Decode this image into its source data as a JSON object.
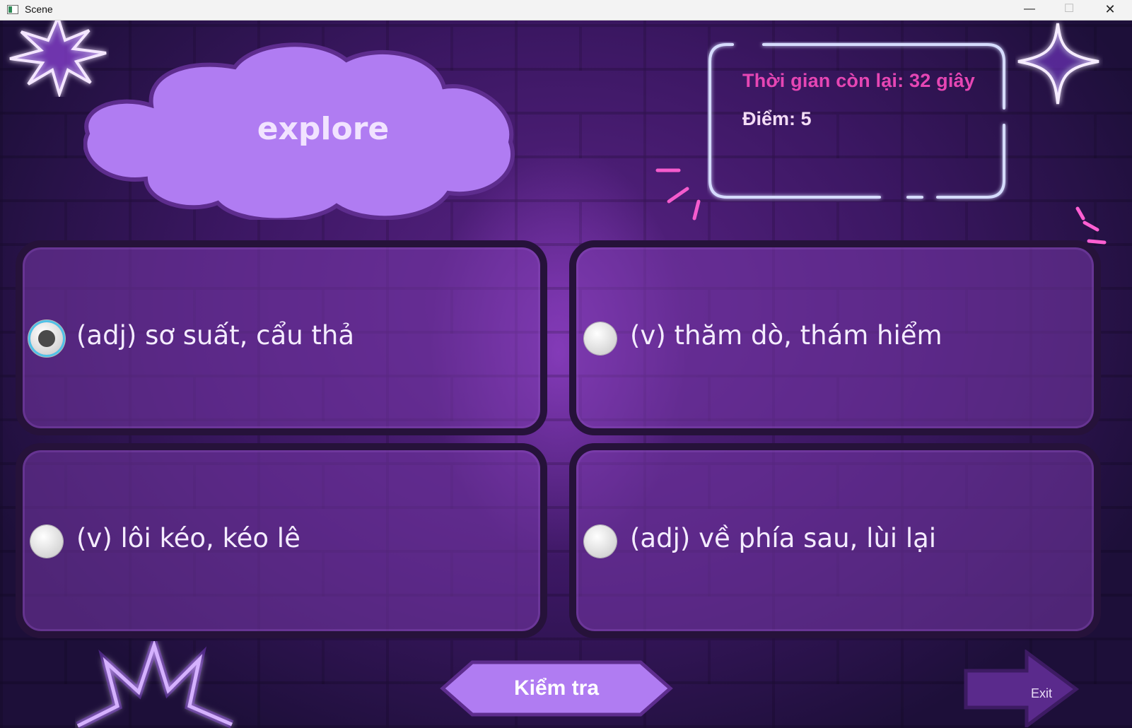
{
  "window": {
    "title": "Scene",
    "minimize_label": "—",
    "maximize_label": "☐",
    "close_label": "✕"
  },
  "quiz": {
    "word": "explore",
    "timer_text": "Thời gian còn lại: 32 giây",
    "score_text": "Điểm: 5",
    "options": [
      {
        "label": "(adj) sơ suất, cẩu thả",
        "selected": true
      },
      {
        "label": "(v) thăm dò, thám hiểm",
        "selected": false
      },
      {
        "label": "(v) lôi kéo, kéo lê",
        "selected": false
      },
      {
        "label": "(adj) về phía sau, lùi lại",
        "selected": false
      }
    ],
    "check_label": "Kiểm tra",
    "exit_label": "Exit"
  },
  "colors": {
    "timer": "#e646b4",
    "cloud": "#b07cf2",
    "card": "#6f3aa6",
    "button": "#b07cf2",
    "neon_pink": "#ff5fd2",
    "neon_blue": "#cfd8ff"
  },
  "icons": {
    "app": "app-window-icon",
    "radio_selected": "radio-selected-icon",
    "radio": "radio-unselected-icon",
    "exit_arrow": "arrow-right-icon",
    "star_burst": "neon-star-burst-icon",
    "sparkle": "neon-sparkle-icon"
  }
}
